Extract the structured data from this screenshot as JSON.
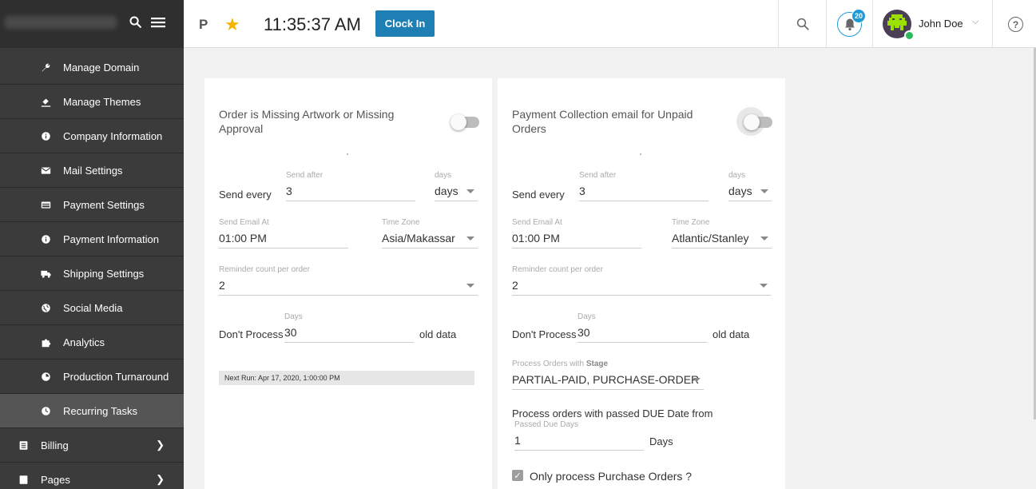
{
  "sidebar": {
    "items": [
      {
        "label": "Manage Domain",
        "icon": "wrench-icon"
      },
      {
        "label": "Manage Themes",
        "icon": "paint-bucket-icon"
      },
      {
        "label": "Company Information",
        "icon": "info-icon"
      },
      {
        "label": "Mail Settings",
        "icon": "envelope-icon"
      },
      {
        "label": "Payment Settings",
        "icon": "credit-card-icon"
      },
      {
        "label": "Payment Information",
        "icon": "info-icon"
      },
      {
        "label": "Shipping Settings",
        "icon": "truck-icon"
      },
      {
        "label": "Social Media",
        "icon": "globe-icon"
      },
      {
        "label": "Analytics",
        "icon": "puzzle-icon"
      },
      {
        "label": "Production Turnaround",
        "icon": "pie-chart-icon"
      },
      {
        "label": "Recurring Tasks",
        "icon": "clock-icon"
      }
    ],
    "billing": "Billing",
    "pages": "Pages"
  },
  "topbar": {
    "p_label": "P",
    "time": "11:35:37 AM",
    "clock_in": "Clock In",
    "notification_count": "20",
    "user_name": "John Doe",
    "help": "?"
  },
  "card1": {
    "title": "Order is Missing Artwork or Missing Approval",
    "send_every": "Send every",
    "send_after_label": "Send after",
    "send_after_value": "3",
    "days_label": "days",
    "days_value": "days",
    "send_email_at_label": "Send Email At",
    "send_email_at_value": "01:00 PM",
    "time_zone_label": "Time Zone",
    "time_zone_value": "Asia/Makassar",
    "reminder_label": "Reminder count per order",
    "reminder_value": "2",
    "dont_process": "Don't Process",
    "days_field_label": "Days",
    "days_field_value": "30",
    "old_data": "old data",
    "next_run": "Next Run: Apr 17, 2020, 1:00:00 PM"
  },
  "card2": {
    "title": "Payment Collection email for Unpaid Orders",
    "send_every": "Send every",
    "send_after_label": "Send after",
    "send_after_value": "3",
    "days_label": "days",
    "days_value": "days",
    "send_email_at_label": "Send Email At",
    "send_email_at_value": "01:00 PM",
    "time_zone_label": "Time Zone",
    "time_zone_value": "Atlantic/Stanley",
    "reminder_label": "Reminder count per order",
    "reminder_value": "2",
    "dont_process": "Don't Process",
    "days_field_label": "Days",
    "days_field_value": "30",
    "old_data": "old data",
    "stage_label_prefix": "Process Orders with",
    "stage_label_bold": "Stage",
    "stage_value": "PARTIAL-PAID, PURCHASE-ORDER",
    "due_date_title": "Process orders with passed DUE Date from",
    "passed_due_label": "Passed Due Days",
    "passed_due_value": "1",
    "days_suffix": "Days",
    "only_po_label": "Only process Purchase Orders ?"
  },
  "colors": {
    "sidebar_bg": "#3b3b3b",
    "accent": "#1e7fb4",
    "star": "#f5b400",
    "badge": "#1e9ad6"
  }
}
